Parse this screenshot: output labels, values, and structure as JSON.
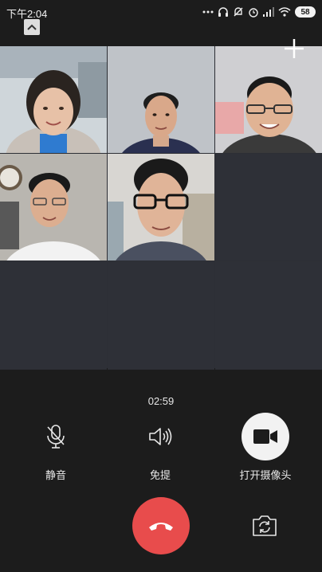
{
  "status_bar": {
    "time": "下午2:04",
    "battery": "58",
    "icons": [
      "more-dots-icon",
      "headphones-icon",
      "bell-off-icon",
      "alarm-icon",
      "signal-icon",
      "wifi-icon",
      "battery-icon"
    ]
  },
  "call": {
    "duration": "02:59"
  },
  "participants": [
    {
      "tile": "participant-1",
      "shirt": "#2f7bd0",
      "coat": "#c8c0b8",
      "bg": "#cfd6da"
    },
    {
      "tile": "participant-2",
      "shirt": "#2a3050",
      "coat": "#3a4568",
      "bg": "#bfc3c8"
    },
    {
      "tile": "participant-3",
      "shirt": "#3a3a3a",
      "coat": "#5a5a5a",
      "bg": "#cfcfd2"
    },
    {
      "tile": "participant-4",
      "shirt": "#f2f2f2",
      "coat": "#e0e0e0",
      "bg": "#b9b6b0"
    },
    {
      "tile": "participant-5",
      "shirt": "#4a5060",
      "coat": "#383e4c",
      "bg": "#d8d6d2"
    }
  ],
  "controls": {
    "mute_label": "静音",
    "speaker_label": "免提",
    "camera_label": "打开摄像头"
  },
  "colors": {
    "background": "#1c1c1c",
    "hangup": "#e84c4c",
    "empty_tile": "#2e3037"
  }
}
